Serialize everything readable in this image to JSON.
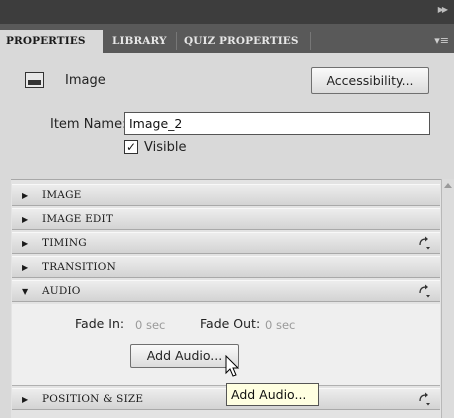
{
  "header": {
    "tabs": [
      {
        "label": "PROPERTIES",
        "active": true
      },
      {
        "label": "LIBRARY",
        "active": false
      },
      {
        "label": "QUIZ PROPERTIES",
        "active": false
      }
    ],
    "collapse_icon": "double-chevron-right-icon",
    "menu_icon": "panel-menu-icon"
  },
  "item": {
    "type_label": "Image",
    "type_icon": "image-icon",
    "accessibility_button": "Accessibility...",
    "name_label": "Item Name:",
    "name_value": "Image_2",
    "visible_label": "Visible",
    "visible_checked": true
  },
  "sections": [
    {
      "label": "IMAGE",
      "expanded": false,
      "has_reset": false
    },
    {
      "label": "IMAGE EDIT",
      "expanded": false,
      "has_reset": false
    },
    {
      "label": "TIMING",
      "expanded": false,
      "has_reset": true
    },
    {
      "label": "TRANSITION",
      "expanded": false,
      "has_reset": false
    },
    {
      "label": "AUDIO",
      "expanded": true,
      "has_reset": true
    },
    {
      "label": "POSITION & SIZE",
      "expanded": false,
      "has_reset": true
    }
  ],
  "audio": {
    "fade_in_label": "Fade In:",
    "fade_in_value": "0 sec",
    "fade_out_label": "Fade Out:",
    "fade_out_value": "0 sec",
    "add_audio_button": "Add Audio..."
  },
  "tooltip": {
    "text": "Add Audio..."
  },
  "colors": {
    "panel_bg": "#d9d9d9",
    "tab_bar": "#595959",
    "top_bar": "#3d3d3d",
    "tooltip_bg": "#ffffe1"
  }
}
